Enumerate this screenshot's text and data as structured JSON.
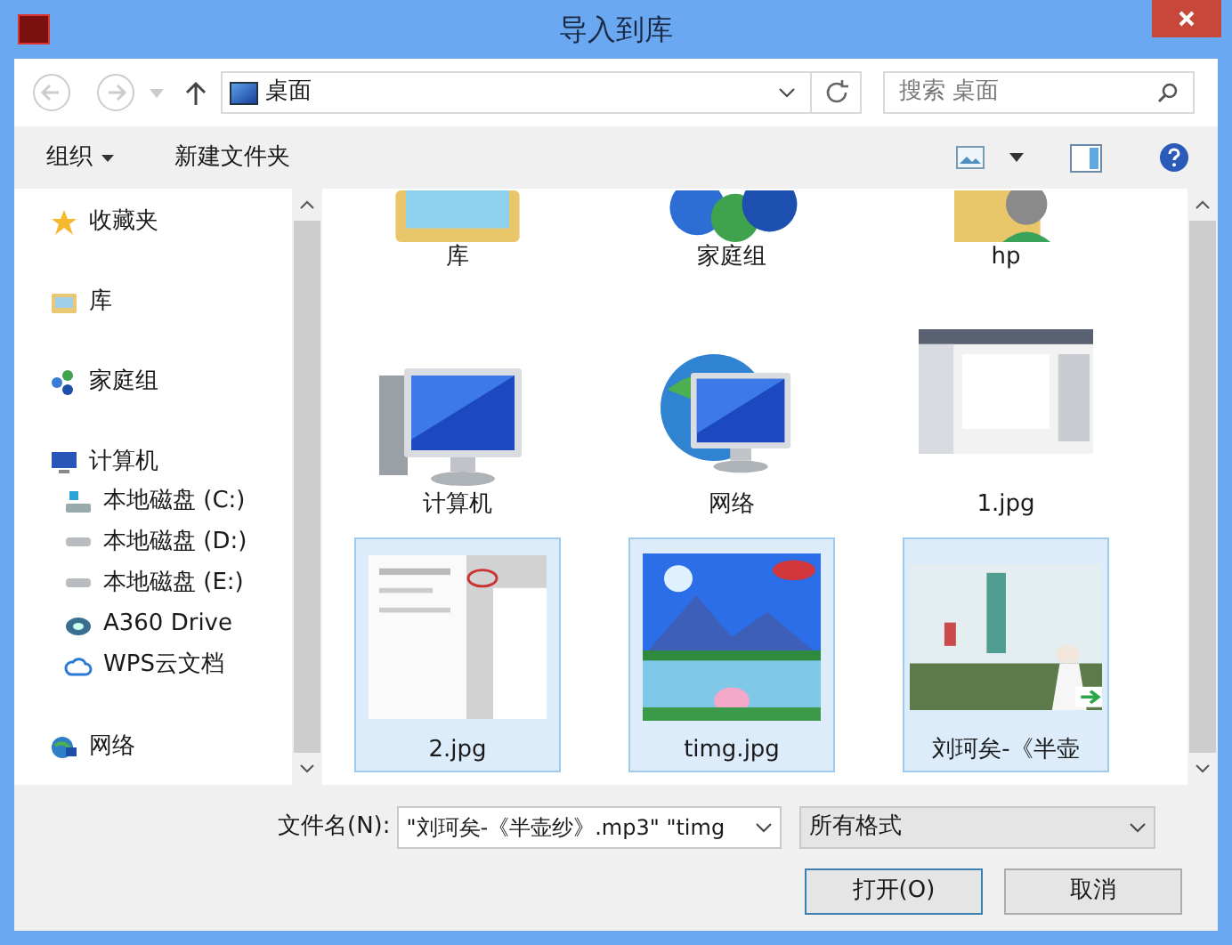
{
  "window": {
    "title": "导入到库"
  },
  "address": {
    "path": "桌面",
    "search_placeholder": "搜索 桌面"
  },
  "toolbar": {
    "organize": "组织",
    "new_folder": "新建文件夹"
  },
  "sidebar": {
    "items": [
      {
        "label": "收藏夹",
        "kind": "favorites"
      },
      {
        "label": "库",
        "kind": "library"
      },
      {
        "label": "家庭组",
        "kind": "homegroup"
      },
      {
        "label": "计算机",
        "kind": "computer",
        "children": [
          {
            "label": "本地磁盘 (C:)",
            "kind": "system-drive"
          },
          {
            "label": "本地磁盘 (D:)",
            "kind": "drive"
          },
          {
            "label": "本地磁盘 (E:)",
            "kind": "drive"
          },
          {
            "label": "A360 Drive",
            "kind": "a360"
          },
          {
            "label": "WPS云文档",
            "kind": "cloud"
          }
        ]
      },
      {
        "label": "网络",
        "kind": "network"
      }
    ]
  },
  "files": [
    {
      "name": "库",
      "kind": "library",
      "selected": false
    },
    {
      "name": "家庭组",
      "kind": "homegroup",
      "selected": false
    },
    {
      "name": "hp",
      "kind": "user",
      "selected": false
    },
    {
      "name": "计算机",
      "kind": "computer",
      "selected": false
    },
    {
      "name": "网络",
      "kind": "network",
      "selected": false
    },
    {
      "name": "1.jpg",
      "kind": "screenshot",
      "selected": false
    },
    {
      "name": "2.jpg",
      "kind": "screenshot-light",
      "selected": true
    },
    {
      "name": "timg.jpg",
      "kind": "landscape",
      "selected": true
    },
    {
      "name": "刘珂矣-《半壶",
      "kind": "album",
      "selected": true
    }
  ],
  "footer": {
    "filename_label": "文件名(N):",
    "filename_value": "\"刘珂矣-《半壶纱》.mp3\" \"timg",
    "filter": "所有格式",
    "buttons": [
      "打开(O)",
      "取消"
    ]
  }
}
